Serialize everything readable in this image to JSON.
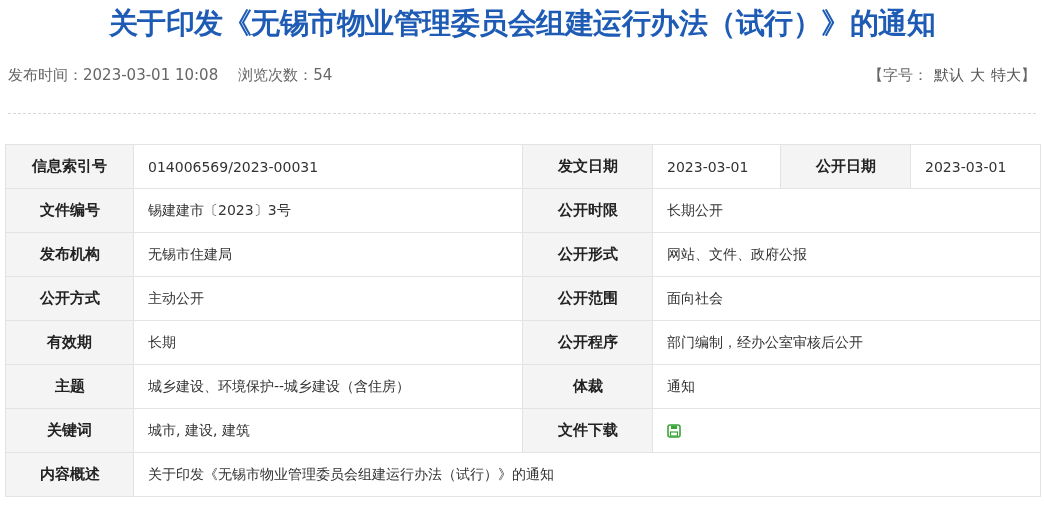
{
  "title": "关于印发《无锡市物业管理委员会组建运行办法（试行）》的通知",
  "meta": {
    "publish_time": "发布时间：2023-03-01 10:08",
    "views": "浏览次数：54",
    "font_size": {
      "open": "【字号：",
      "options": [
        "默认",
        "大",
        "特大"
      ],
      "close": "】"
    }
  },
  "rows": [
    [
      {
        "kind": "label",
        "text": "信息索引号"
      },
      {
        "kind": "value",
        "text": "014006569/2023-00031"
      },
      {
        "kind": "label",
        "text": "发文日期"
      },
      {
        "kind": "value",
        "text": "2023-03-01"
      },
      {
        "kind": "label",
        "text": "公开日期"
      },
      {
        "kind": "value",
        "text": "2023-03-01"
      }
    ],
    [
      {
        "kind": "label",
        "text": "文件编号"
      },
      {
        "kind": "value",
        "text": "锡建建市〔2023〕3号"
      },
      {
        "kind": "label",
        "text": "公开时限"
      },
      {
        "kind": "value",
        "text": "长期公开"
      }
    ],
    [
      {
        "kind": "label",
        "text": "发布机构"
      },
      {
        "kind": "value",
        "text": "无锡市住建局"
      },
      {
        "kind": "label",
        "text": "公开形式"
      },
      {
        "kind": "value",
        "text": "网站、文件、政府公报"
      }
    ],
    [
      {
        "kind": "label",
        "text": "公开方式"
      },
      {
        "kind": "value",
        "text": "主动公开"
      },
      {
        "kind": "label",
        "text": "公开范围"
      },
      {
        "kind": "value",
        "text": "面向社会"
      }
    ],
    [
      {
        "kind": "label",
        "text": "有效期"
      },
      {
        "kind": "value",
        "text": "长期"
      },
      {
        "kind": "label",
        "text": "公开程序"
      },
      {
        "kind": "value",
        "text": "部门编制，经办公室审核后公开"
      }
    ],
    [
      {
        "kind": "label",
        "text": "主题"
      },
      {
        "kind": "value",
        "text": "城乡建设、环境保护--城乡建设（含住房）"
      },
      {
        "kind": "label",
        "text": "体裁"
      },
      {
        "kind": "value",
        "text": "通知"
      }
    ],
    [
      {
        "kind": "label",
        "text": "关键词"
      },
      {
        "kind": "value",
        "text": "城市, 建设, 建筑"
      },
      {
        "kind": "label",
        "text": "文件下载"
      },
      {
        "kind": "download"
      }
    ],
    [
      {
        "kind": "label",
        "text": "内容概述"
      },
      {
        "kind": "value",
        "text": "关于印发《无锡市物业管理委员会组建运行办法（试行）》的通知"
      }
    ]
  ]
}
